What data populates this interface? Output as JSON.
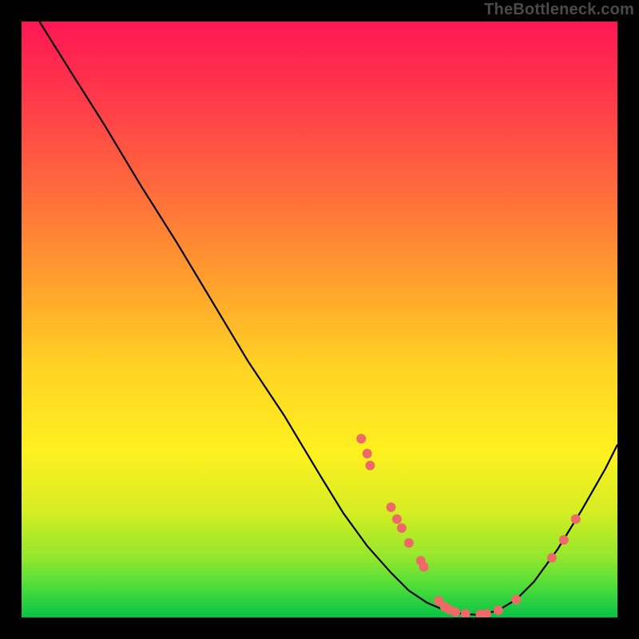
{
  "watermark": "TheBottleneck.com",
  "gradient_colors": {
    "top": "#ff1754",
    "upper": "#ff6a3c",
    "mid": "#ffd323",
    "lower": "#d6ee22",
    "bottom": "#07c247"
  },
  "chart_data": {
    "type": "line",
    "title": "",
    "xlabel": "",
    "ylabel": "",
    "xlim": [
      0,
      100
    ],
    "ylim": [
      0,
      100
    ],
    "x": [
      3,
      8,
      14,
      20,
      26,
      32,
      38,
      44,
      50,
      54,
      58,
      62,
      65,
      68,
      71,
      74,
      77,
      80,
      83,
      86,
      90,
      94,
      98,
      100
    ],
    "y": [
      100,
      92,
      82.5,
      72.5,
      63,
      53,
      43,
      34,
      24,
      17.5,
      12,
      7.5,
      4.5,
      2.5,
      1.2,
      0.6,
      0.4,
      1.2,
      3,
      6,
      11.5,
      18,
      25,
      29
    ],
    "markers": [
      {
        "x": 57.0,
        "y": 30.0
      },
      {
        "x": 58.0,
        "y": 27.5
      },
      {
        "x": 58.5,
        "y": 25.5
      },
      {
        "x": 62.0,
        "y": 18.5
      },
      {
        "x": 63.0,
        "y": 16.5
      },
      {
        "x": 63.8,
        "y": 15.0
      },
      {
        "x": 65.0,
        "y": 12.5
      },
      {
        "x": 67.0,
        "y": 9.5
      },
      {
        "x": 67.5,
        "y": 8.5
      },
      {
        "x": 70.0,
        "y": 2.8
      },
      {
        "x": 71.0,
        "y": 1.8
      },
      {
        "x": 71.8,
        "y": 1.3
      },
      {
        "x": 72.8,
        "y": 0.9
      },
      {
        "x": 74.5,
        "y": 0.6
      },
      {
        "x": 77.0,
        "y": 0.5
      },
      {
        "x": 78.0,
        "y": 0.6
      },
      {
        "x": 80.0,
        "y": 1.2
      },
      {
        "x": 83.0,
        "y": 3.0
      },
      {
        "x": 89.0,
        "y": 10.0
      },
      {
        "x": 91.0,
        "y": 13.0
      },
      {
        "x": 93.0,
        "y": 16.5
      }
    ],
    "marker_color": "#ee6a66",
    "line_color": "#000000"
  }
}
